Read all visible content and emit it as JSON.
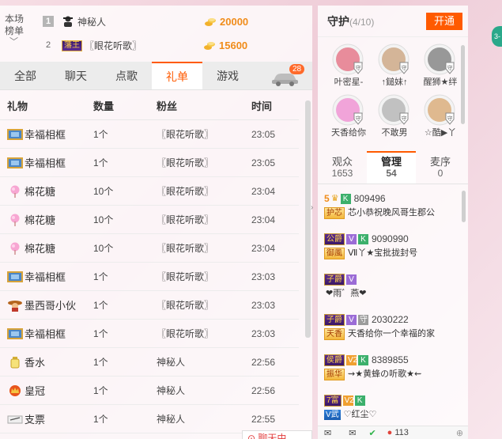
{
  "rank": {
    "label": "本场\n榜单",
    "rows": [
      {
        "num": "1",
        "name": "神秘人",
        "score": "20000",
        "badge": ""
      },
      {
        "num": "2",
        "name": "〖眼花听歌〗",
        "score": "15600",
        "badge": "藩王"
      }
    ]
  },
  "tabs": [
    {
      "label": "全部"
    },
    {
      "label": "聊天"
    },
    {
      "label": "点歌"
    },
    {
      "label": "礼单"
    },
    {
      "label": "游戏"
    }
  ],
  "tab_badge": "28",
  "list": {
    "headers": {
      "gift": "礼物",
      "qty": "数量",
      "fan": "粉丝",
      "time": "时间"
    },
    "rows": [
      {
        "gift": "幸福相框",
        "qty": "1个",
        "fan": "〖眼花听歌〗",
        "time": "23:05",
        "icon": "frame"
      },
      {
        "gift": "幸福相框",
        "qty": "1个",
        "fan": "〖眼花听歌〗",
        "time": "23:05",
        "icon": "frame"
      },
      {
        "gift": "棉花糖",
        "qty": "10个",
        "fan": "〖眼花听歌〗",
        "time": "23:04",
        "icon": "candy"
      },
      {
        "gift": "棉花糖",
        "qty": "10个",
        "fan": "〖眼花听歌〗",
        "time": "23:04",
        "icon": "candy"
      },
      {
        "gift": "棉花糖",
        "qty": "10个",
        "fan": "〖眼花听歌〗",
        "time": "23:04",
        "icon": "candy"
      },
      {
        "gift": "幸福相框",
        "qty": "1个",
        "fan": "〖眼花听歌〗",
        "time": "23:03",
        "icon": "frame"
      },
      {
        "gift": "墨西哥小伙",
        "qty": "1个",
        "fan": "〖眼花听歌〗",
        "time": "23:03",
        "icon": "mexican"
      },
      {
        "gift": "幸福相框",
        "qty": "1个",
        "fan": "〖眼花听歌〗",
        "time": "23:03",
        "icon": "frame"
      },
      {
        "gift": "香水",
        "qty": "1个",
        "fan": "神秘人",
        "time": "22:56",
        "icon": "perfume"
      },
      {
        "gift": "皇冠",
        "qty": "1个",
        "fan": "神秘人",
        "time": "22:56",
        "icon": "crown"
      },
      {
        "gift": "支票",
        "qty": "1个",
        "fan": "神秘人",
        "time": "22:55",
        "icon": "cheque"
      }
    ]
  },
  "chat_button": "聊天中...",
  "guard": {
    "title": "守护",
    "count": "(4/10)",
    "open_label": "开通",
    "members": [
      {
        "name": "叶密星-",
        "color": "#e46a7e"
      },
      {
        "name": "↑鎚妹↑",
        "color": "#c9a07a"
      },
      {
        "name": "醒狮★绊",
        "color": "#7a7a7a"
      },
      {
        "name": "天香给你",
        "color": "#f08ad0"
      },
      {
        "name": "不敢男",
        "color": "#b0b0b0"
      },
      {
        "name": "☆酷▶丫",
        "color": "#d8a66e"
      }
    ]
  },
  "viewer_tabs": [
    {
      "label": "观众",
      "count": "1653"
    },
    {
      "label": "管理",
      "count": "54"
    },
    {
      "label": "麦序",
      "count": "0"
    }
  ],
  "members": [
    {
      "lvl": "5",
      "title": "",
      "tags": [
        "K"
      ],
      "id": "809496",
      "fan": "护芯",
      "msg": "芯小恭祝晚风哥生郡公"
    },
    {
      "lvl": "",
      "title": "公爵",
      "tags": [
        "V",
        "K"
      ],
      "id": "9090990",
      "fan": "御風",
      "msg": "Ⅶ丫★宝批拢封号"
    },
    {
      "lvl": "",
      "title": "子爵",
      "tags": [
        "V"
      ],
      "id": "",
      "fan": "",
      "msg": "❤雨゛燕❤"
    },
    {
      "lvl": "",
      "title": "子爵",
      "tags": [
        "V",
        "守"
      ],
      "id": "2030222",
      "fan": "天香",
      "msg": "天香给你一个幸福的家"
    },
    {
      "lvl": "",
      "title": "侯爵",
      "tags": [
        "V2",
        "K"
      ],
      "id": "8389855",
      "fan": "振华",
      "msg": "⇝★黄蜂の听歌★⇜"
    },
    {
      "lvl": "",
      "title": "7富",
      "tags": [
        "V2",
        "K"
      ],
      "id": "",
      "fan": "V武",
      "msg": "♡红尘♡"
    }
  ],
  "bottom": {
    "online": "113"
  }
}
